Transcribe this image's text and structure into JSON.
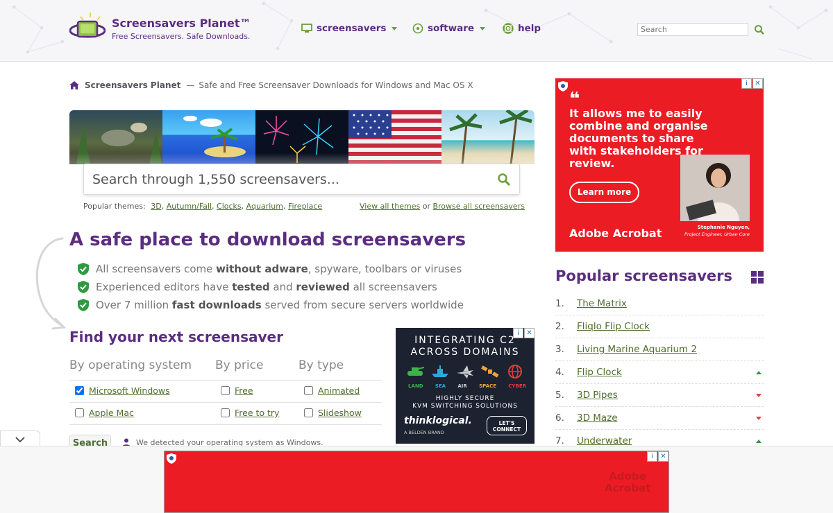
{
  "header": {
    "brand_title": "Screensavers Planet™",
    "brand_subtitle": "Free Screensavers. Safe Downloads.",
    "nav": [
      {
        "label": "screensavers",
        "icon": "monitor-icon",
        "has_caret": true
      },
      {
        "label": "software",
        "icon": "disc-icon",
        "has_caret": true
      },
      {
        "label": "help",
        "icon": "lifebuoy-icon",
        "has_caret": false
      }
    ],
    "search_placeholder": "Search"
  },
  "breadcrumb": {
    "home": "Screensavers Planet",
    "separator": "—",
    "text": "Safe and Free Screensaver Downloads for Windows and Mac OS X"
  },
  "hero": {
    "search_placeholder": "Search through 1,550 screensavers...",
    "popular_label": "Popular themes:",
    "themes": [
      "3D",
      "Autumn/Fall",
      "Clocks",
      "Aquarium",
      "Fireplace"
    ],
    "view_all": "View all themes",
    "or": "or",
    "browse_all": "Browse all screensavers"
  },
  "safe": {
    "title": "A safe place to download screensavers",
    "f1_pre": "All screensavers come ",
    "f1_b1": "without adware",
    "f1_post": ", spyware, toolbars or viruses",
    "f2_pre": "Experienced editors have ",
    "f2_b1": "tested",
    "f2_mid": " and ",
    "f2_b2": "reviewed",
    "f2_post": " all screensavers",
    "f3_pre": "Over 7 million ",
    "f3_b1": "fast downloads",
    "f3_post": " served from secure servers worldwide"
  },
  "finder": {
    "title": "Find your next screensaver",
    "col_os": "By operating system",
    "col_price": "By price",
    "col_type": "By type",
    "os_windows": "Microsoft Windows",
    "os_windows_checked": true,
    "os_mac": "Apple Mac",
    "price_free": "Free",
    "price_try": "Free to try",
    "type_animated": "Animated",
    "type_slideshow": "Slideshow",
    "search_button": "Search",
    "detected": "We detected your operating system as Windows."
  },
  "ad_small": {
    "headline_1": "INTEGRATING C2",
    "headline_2": "ACROSS DOMAINS",
    "domains": [
      "LAND",
      "SEA",
      "AIR",
      "SPACE",
      "CYBER"
    ],
    "domain_colors": [
      "#3cb44b",
      "#2aa8d8",
      "#c9ccd2",
      "#f2a33a",
      "#e63a3a"
    ],
    "sub_1": "HIGHLY SECURE",
    "sub_2": "KVM SWITCHING SOLUTIONS",
    "brand": "thinklogical.",
    "brand_sub": "A BELDEN BRAND",
    "cta_1": "LET'S",
    "cta_2": "CONNECT"
  },
  "ad_big": {
    "quote_mark": "❝",
    "message": "It allows me to easily combine and organise documents to share with stakeholders for review.",
    "cta": "Learn more",
    "logo": "Adobe Acrobat",
    "person_name": "Stephanie Nguyen,",
    "person_title": "Project Engineer, Urban Core"
  },
  "popular": {
    "title": "Popular screensavers",
    "items": [
      {
        "num": "1.",
        "name": "The Matrix",
        "trend": ""
      },
      {
        "num": "2.",
        "name": "Fliqlo Flip Clock",
        "trend": ""
      },
      {
        "num": "3.",
        "name": "Living Marine Aquarium 2",
        "trend": ""
      },
      {
        "num": "4.",
        "name": "Flip Clock",
        "trend": "up"
      },
      {
        "num": "5.",
        "name": "3D Pipes",
        "trend": "down"
      },
      {
        "num": "6.",
        "name": "3D Maze",
        "trend": "down"
      },
      {
        "num": "7.",
        "name": "Underwater",
        "trend": "up"
      }
    ]
  },
  "ad_bottom": {
    "watermark_1": "Adobe",
    "watermark_2": "Acrobat"
  },
  "colors": {
    "brand_purple": "#5b2d82",
    "link_green": "#4f6e2c",
    "ad_red": "#ec1c24"
  }
}
